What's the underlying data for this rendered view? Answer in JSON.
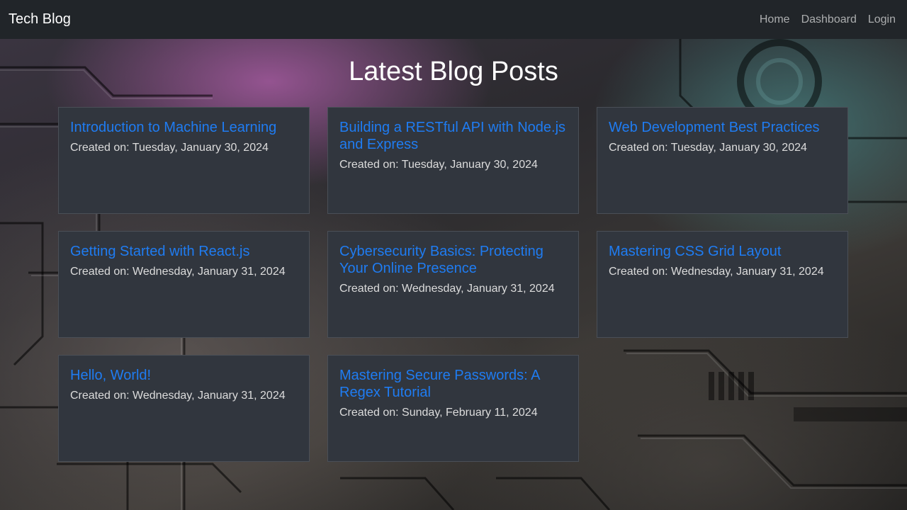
{
  "navbar": {
    "brand": "Tech Blog",
    "links": [
      "Home",
      "Dashboard",
      "Login"
    ]
  },
  "main": {
    "title": "Latest Blog Posts",
    "posts": [
      {
        "title": "Introduction to Machine Learning",
        "date": "Created on: Tuesday, January 30, 2024"
      },
      {
        "title": "Building a RESTful API with Node.js and Express",
        "date": "Created on: Tuesday, January 30, 2024"
      },
      {
        "title": "Web Development Best Practices",
        "date": "Created on: Tuesday, January 30, 2024"
      },
      {
        "title": "Getting Started with React.js",
        "date": "Created on: Wednesday, January 31, 2024"
      },
      {
        "title": "Cybersecurity Basics: Protecting Your Online Presence",
        "date": "Created on: Wednesday, January 31, 2024"
      },
      {
        "title": "Mastering CSS Grid Layout",
        "date": "Created on: Wednesday, January 31, 2024"
      },
      {
        "title": "Hello, World!",
        "date": "Created on: Wednesday, January 31, 2024"
      },
      {
        "title": "Mastering Secure Passwords: A Regex Tutorial",
        "date": "Created on: Sunday, February 11, 2024"
      }
    ]
  },
  "colors": {
    "navbar_bg": "#212529",
    "card_bg": "#31363e",
    "link": "#1f7cf2"
  }
}
